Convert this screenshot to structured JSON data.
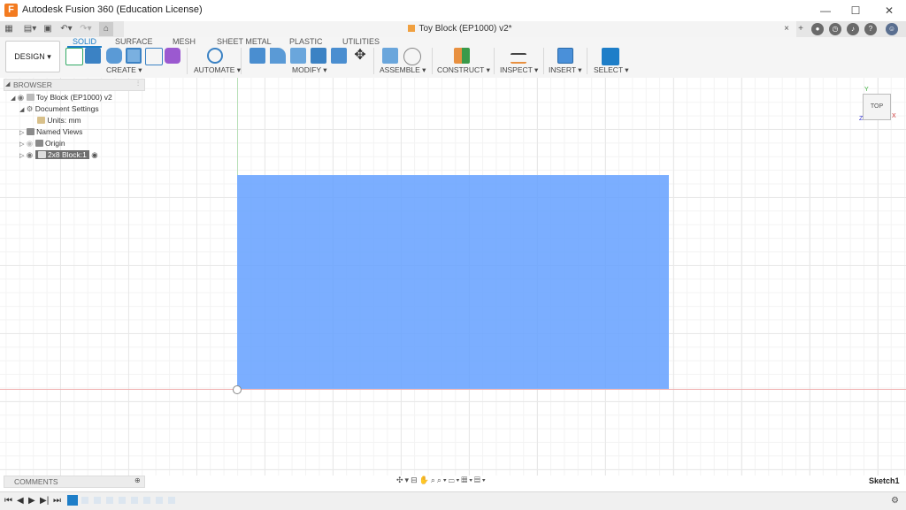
{
  "window": {
    "title": "Autodesk Fusion 360 (Education License)",
    "controls": [
      "minimize-icon",
      "maximize-icon",
      "close-icon"
    ]
  },
  "document_tab": {
    "label": "Toy Block (EP1000) v2*",
    "close_label": "×"
  },
  "workspace": {
    "label": "DESIGN ▾"
  },
  "workspace_tabs": [
    "SOLID",
    "SURFACE",
    "MESH",
    "SHEET METAL",
    "PLASTIC",
    "UTILITIES"
  ],
  "active_tab": "SOLID",
  "tool_groups": [
    "CREATE ▾",
    "AUTOMATE ▾",
    "MODIFY ▾",
    "ASSEMBLE ▾",
    "CONSTRUCT ▾",
    "INSPECT ▾",
    "INSERT ▾",
    "SELECT ▾"
  ],
  "browser": {
    "title": "BROWSER",
    "items": [
      {
        "label": "Toy Block (EP1000) v2"
      },
      {
        "label": "Document Settings"
      },
      {
        "label": "Units: mm"
      },
      {
        "label": "Named Views"
      },
      {
        "label": "Origin"
      },
      {
        "label": "2x8 Block:1"
      }
    ]
  },
  "viewcube": {
    "label": "TOP",
    "axis_y": "Y",
    "axis_z": "Z",
    "axis_x": "X"
  },
  "comments": {
    "label": "COMMENTS"
  },
  "status": {
    "sketch_label": "Sketch1"
  },
  "colors": {
    "accent": "#1e7ec8",
    "sketch_fill": "#64a0ff",
    "axis_x": "#f0b0b0",
    "axis_y": "#b8e0b8"
  }
}
